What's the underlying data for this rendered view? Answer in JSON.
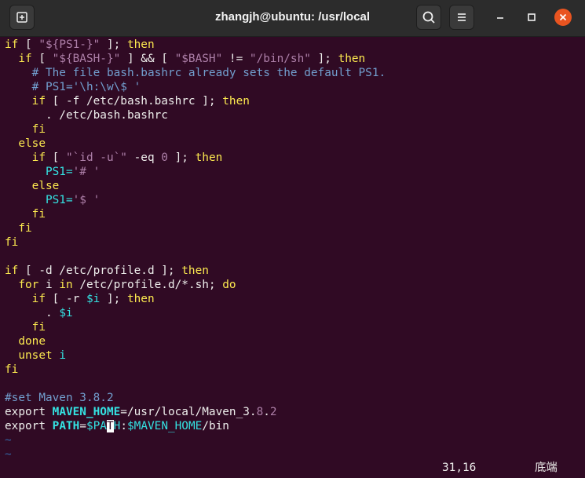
{
  "window": {
    "title": "zhangjh@ubuntu: /usr/local",
    "icons": {
      "new_tab": "new-tab-icon",
      "search": "search-icon",
      "menu": "hamburger-menu-icon",
      "minimize": "minimize-icon",
      "maximize": "maximize-icon",
      "close": "close-icon"
    }
  },
  "colors": {
    "terminal_bg": "#300a24",
    "keyword": "#fce94f",
    "string": "#ad7fa8",
    "comment": "#729fcf",
    "variable": "#34e2e2",
    "close_button": "#e95420"
  },
  "editor": {
    "lines": [
      [
        "if",
        " [ ",
        "\"${PS1-}\"",
        " ]; ",
        "then"
      ],
      [
        "  if",
        " [ ",
        "\"${BASH-}\"",
        " ] && [ ",
        "\"$BASH\"",
        " != ",
        "\"/bin/sh\"",
        " ]; ",
        "then"
      ],
      [
        "    # The file bash.bashrc already sets the default PS1."
      ],
      [
        "    # PS1='\\h:\\w\\$ '"
      ],
      [
        "    if",
        " [ -f /etc/bash.bashrc ]; ",
        "then"
      ],
      [
        "      . /etc/bash.bashrc"
      ],
      [
        "    fi"
      ],
      [
        "  else"
      ],
      [
        "    if",
        " [ ",
        "\"`id -u`\"",
        " -eq ",
        "0",
        " ]; ",
        "then"
      ],
      [
        "      PS1=",
        "'# '"
      ],
      [
        "    else"
      ],
      [
        "      PS1=",
        "'$ '"
      ],
      [
        "    fi"
      ],
      [
        "  fi"
      ],
      [
        "fi"
      ],
      [
        ""
      ],
      [
        "if",
        " [ -d /etc/profile.d ]; ",
        "then"
      ],
      [
        "  for",
        " i ",
        "in",
        " /etc/profile.d/*.sh; ",
        "do"
      ],
      [
        "    if",
        " [ -r ",
        "$i",
        " ]; ",
        "then"
      ],
      [
        "      . ",
        "$i"
      ],
      [
        "    fi"
      ],
      [
        "  done"
      ],
      [
        "  unset",
        " ",
        "i"
      ],
      [
        "fi"
      ],
      [
        ""
      ],
      [
        "#set Maven 3.8.2"
      ],
      [
        "export ",
        "MAVEN_HOME",
        "=/usr/local/Maven_3.",
        "8",
        ".",
        "2"
      ],
      [
        "export ",
        "PATH",
        "=",
        "$PA",
        "T",
        "H",
        ":",
        "$MAVEN_HOME",
        "/bin"
      ],
      [
        "~"
      ],
      [
        "~"
      ]
    ],
    "styles": [
      [
        "kw",
        "",
        "str",
        "",
        "kw"
      ],
      [
        "kw",
        "",
        "str",
        "",
        "str",
        "",
        "str",
        "",
        "kw"
      ],
      [
        "cmt"
      ],
      [
        "cmt"
      ],
      [
        "kw",
        "",
        "kw"
      ],
      [
        ""
      ],
      [
        "kw"
      ],
      [
        "kw"
      ],
      [
        "kw",
        "",
        "str",
        "",
        "str",
        "",
        "kw"
      ],
      [
        "var",
        "str"
      ],
      [
        "kw"
      ],
      [
        "var",
        "str"
      ],
      [
        "kw"
      ],
      [
        "kw"
      ],
      [
        "kw"
      ],
      [
        ""
      ],
      [
        "kw",
        "",
        "kw"
      ],
      [
        "kw",
        "",
        "kw",
        "",
        "kw"
      ],
      [
        "kw",
        "",
        "var",
        "",
        "kw"
      ],
      [
        "",
        "var"
      ],
      [
        "kw"
      ],
      [
        "kw"
      ],
      [
        "kw",
        "",
        "var"
      ],
      [
        "kw"
      ],
      [
        ""
      ],
      [
        "cmt"
      ],
      [
        "",
        "vname",
        "",
        "str",
        "",
        "str"
      ],
      [
        "",
        "vname",
        "",
        "var",
        "cursor",
        "var",
        "",
        "var",
        ""
      ],
      [
        "tilde"
      ],
      [
        "tilde"
      ]
    ],
    "cursor_position": "31,16",
    "scroll_position": "底端"
  }
}
